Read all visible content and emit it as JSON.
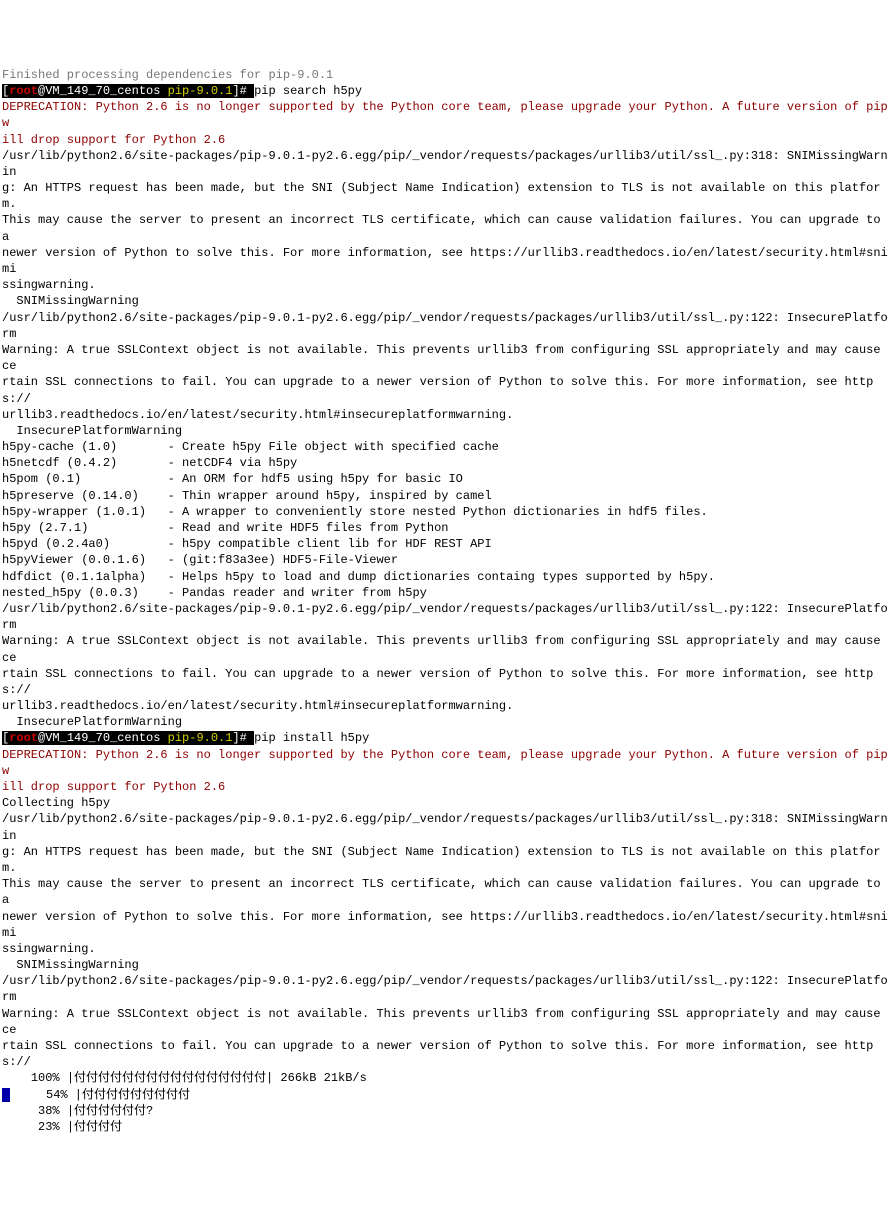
{
  "line_prev": "Finished processing dependencies for pip-9.0.1",
  "prompt1": {
    "bracket_open": "[",
    "user": "root",
    "at_host": "@VM_149_70_centos ",
    "cwd": "pip-9.0.1",
    "bracket_close": "]# ",
    "command": "pip search h5py"
  },
  "dep1_a": "DEPRECATION: Python 2.6 is no longer supported by the Python core team, please upgrade your Python. A future version of pip w",
  "dep1_b": "ill drop support for Python 2.6",
  "warn1_a": "/usr/lib/python2.6/site-packages/pip-9.0.1-py2.6.egg/pip/_vendor/requests/packages/urllib3/util/ssl_.py:318: SNIMissingWarnin",
  "warn1_b": "g: An HTTPS request has been made, but the SNI (Subject Name Indication) extension to TLS is not available on this platform.",
  "warn1_c": "This may cause the server to present an incorrect TLS certificate, which can cause validation failures. You can upgrade to a",
  "warn1_d": "newer version of Python to solve this. For more information, see https://urllib3.readthedocs.io/en/latest/security.html#snimi",
  "warn1_e": "ssingwarning.",
  "warn1_f": "  SNIMissingWarning",
  "warn2_a": "/usr/lib/python2.6/site-packages/pip-9.0.1-py2.6.egg/pip/_vendor/requests/packages/urllib3/util/ssl_.py:122: InsecurePlatform",
  "warn2_b": "Warning: A true SSLContext object is not available. This prevents urllib3 from configuring SSL appropriately and may cause ce",
  "warn2_c": "rtain SSL connections to fail. You can upgrade to a newer version of Python to solve this. For more information, see https://",
  "warn2_d": "urllib3.readthedocs.io/en/latest/security.html#insecureplatformwarning.",
  "warn2_e": "  InsecurePlatformWarning",
  "results": [
    "h5py-cache (1.0)       - Create h5py File object with specified cache",
    "h5netcdf (0.4.2)       - netCDF4 via h5py",
    "h5pom (0.1)            - An ORM for hdf5 using h5py for basic IO",
    "h5preserve (0.14.0)    - Thin wrapper around h5py, inspired by camel",
    "h5py-wrapper (1.0.1)   - A wrapper to conveniently store nested Python dictionaries in hdf5 files.",
    "h5py (2.7.1)           - Read and write HDF5 files from Python",
    "h5pyd (0.2.4a0)        - h5py compatible client lib for HDF REST API",
    "h5pyViewer (0.0.1.6)   - (git:f83a3ee) HDF5-File-Viewer",
    "hdfdict (0.1.1alpha)   - Helps h5py to load and dump dictionaries containg types supported by h5py.",
    "nested_h5py (0.0.3)    - Pandas reader and writer from h5py"
  ],
  "warn3_a": "/usr/lib/python2.6/site-packages/pip-9.0.1-py2.6.egg/pip/_vendor/requests/packages/urllib3/util/ssl_.py:122: InsecurePlatform",
  "warn3_b": "Warning: A true SSLContext object is not available. This prevents urllib3 from configuring SSL appropriately and may cause ce",
  "warn3_c": "rtain SSL connections to fail. You can upgrade to a newer version of Python to solve this. For more information, see https://",
  "warn3_d": "urllib3.readthedocs.io/en/latest/security.html#insecureplatformwarning.",
  "warn3_e": "  InsecurePlatformWarning",
  "prompt2": {
    "bracket_open": "[",
    "user": "root",
    "at_host": "@VM_149_70_centos ",
    "cwd": "pip-9.0.1",
    "bracket_close": "]# ",
    "command": "pip install h5py"
  },
  "dep2_a": "DEPRECATION: Python 2.6 is no longer supported by the Python core team, please upgrade your Python. A future version of pip w",
  "dep2_b": "ill drop support for Python 2.6",
  "collecting": "Collecting h5py",
  "warn4_a": "/usr/lib/python2.6/site-packages/pip-9.0.1-py2.6.egg/pip/_vendor/requests/packages/urllib3/util/ssl_.py:318: SNIMissingWarnin",
  "warn4_b": "g: An HTTPS request has been made, but the SNI (Subject Name Indication) extension to TLS is not available on this platform.",
  "warn4_c": "This may cause the server to present an incorrect TLS certificate, which can cause validation failures. You can upgrade to a",
  "warn4_d": "newer version of Python to solve this. For more information, see https://urllib3.readthedocs.io/en/latest/security.html#snimi",
  "warn4_e": "ssingwarning.",
  "warn4_f": "  SNIMissingWarning",
  "warn5_a": "/usr/lib/python2.6/site-packages/pip-9.0.1-py2.6.egg/pip/_vendor/requests/packages/urllib3/util/ssl_.py:122: InsecurePlatform",
  "warn5_b": "Warning: A true SSLContext object is not available. This prevents urllib3 from configuring SSL appropriately and may cause ce",
  "warn5_c": "rtain SSL connections to fail. You can upgrade to a newer version of Python to solve this. For more information, see https://",
  "prog1": "    100% |付付付付付付付付付付付付付付付付| 266kB 21kB/s",
  "prog2": "     54% |付付付付付付付付付",
  "prog3": "     38% |付付付付付付?",
  "prog4": "     23% |付付付付"
}
